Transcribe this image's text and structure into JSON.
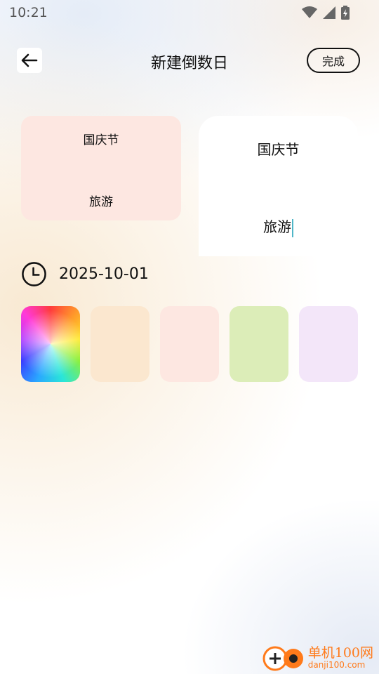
{
  "status_bar": {
    "time": "10:21"
  },
  "header": {
    "title": "新建倒数日",
    "done_label": "完成"
  },
  "preview_card": {
    "name": "国庆节",
    "subtitle": "旅游",
    "color": "#fde7e1"
  },
  "editor": {
    "name": "国庆节",
    "subtitle": "旅游"
  },
  "date": {
    "value": "2025-10-01"
  },
  "swatches": [
    {
      "name": "rainbow-picker",
      "color": "conic"
    },
    {
      "name": "peach",
      "color": "#fbe7cf"
    },
    {
      "name": "pink",
      "color": "#fde7e1"
    },
    {
      "name": "green",
      "color": "#dcedb8"
    },
    {
      "name": "lavender",
      "color": "#f3e6f9"
    }
  ],
  "watermark": {
    "name": "单机100网",
    "url": "danji100.com"
  }
}
